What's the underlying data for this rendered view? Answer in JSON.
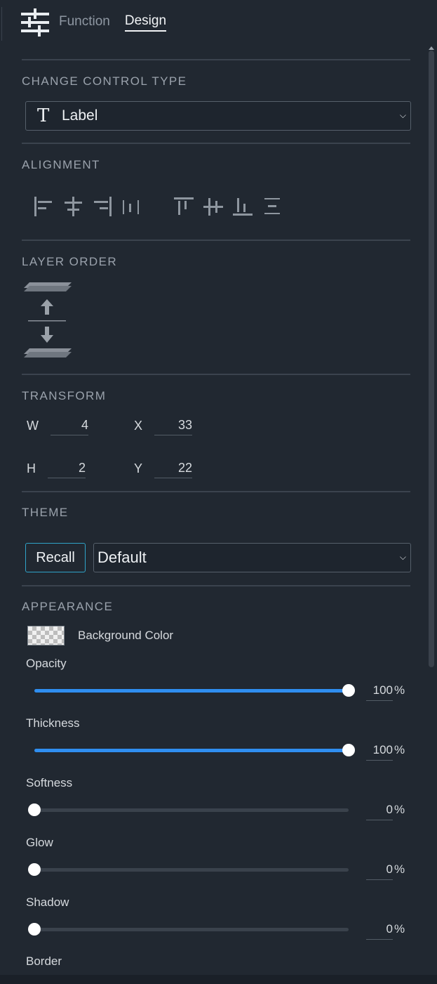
{
  "header": {
    "tabs": [
      {
        "label": "Function",
        "active": false
      },
      {
        "label": "Design",
        "active": true
      }
    ]
  },
  "control_type": {
    "title": "CHANGE CONTROL TYPE",
    "icon_glyph": "T",
    "selected": "Label"
  },
  "alignment": {
    "title": "ALIGNMENT",
    "icons": [
      "align-left-icon",
      "align-center-horizontal-icon",
      "align-right-icon",
      "distribute-horizontal-icon",
      "align-top-icon",
      "align-center-vertical-icon",
      "align-bottom-icon",
      "distribute-vertical-icon"
    ]
  },
  "layer_order": {
    "title": "LAYER ORDER",
    "icons": [
      "bring-forward-icon",
      "send-backward-icon"
    ]
  },
  "transform": {
    "title": "TRANSFORM",
    "w_label": "W",
    "w_value": "4",
    "x_label": "X",
    "x_value": "33",
    "h_label": "H",
    "h_value": "2",
    "y_label": "Y",
    "y_value": "22"
  },
  "theme": {
    "title": "THEME",
    "recall_label": "Recall",
    "selected": "Default"
  },
  "appearance": {
    "title": "APPEARANCE",
    "background_color_label": "Background Color",
    "sliders": [
      {
        "label": "Opacity",
        "value": "100",
        "unit": "%",
        "level": 1.0
      },
      {
        "label": "Thickness",
        "value": "100",
        "unit": "%",
        "level": 1.0
      },
      {
        "label": "Softness",
        "value": "0",
        "unit": "%",
        "level": 0.0
      },
      {
        "label": "Glow",
        "value": "0",
        "unit": "%",
        "level": 0.0
      },
      {
        "label": "Shadow",
        "value": "0",
        "unit": "%",
        "level": 0.0
      }
    ],
    "border_label": "Border"
  },
  "colors": {
    "accent": "#2f8ef0",
    "recall_border": "#2fa3c8",
    "panel_bg": "#212831"
  }
}
